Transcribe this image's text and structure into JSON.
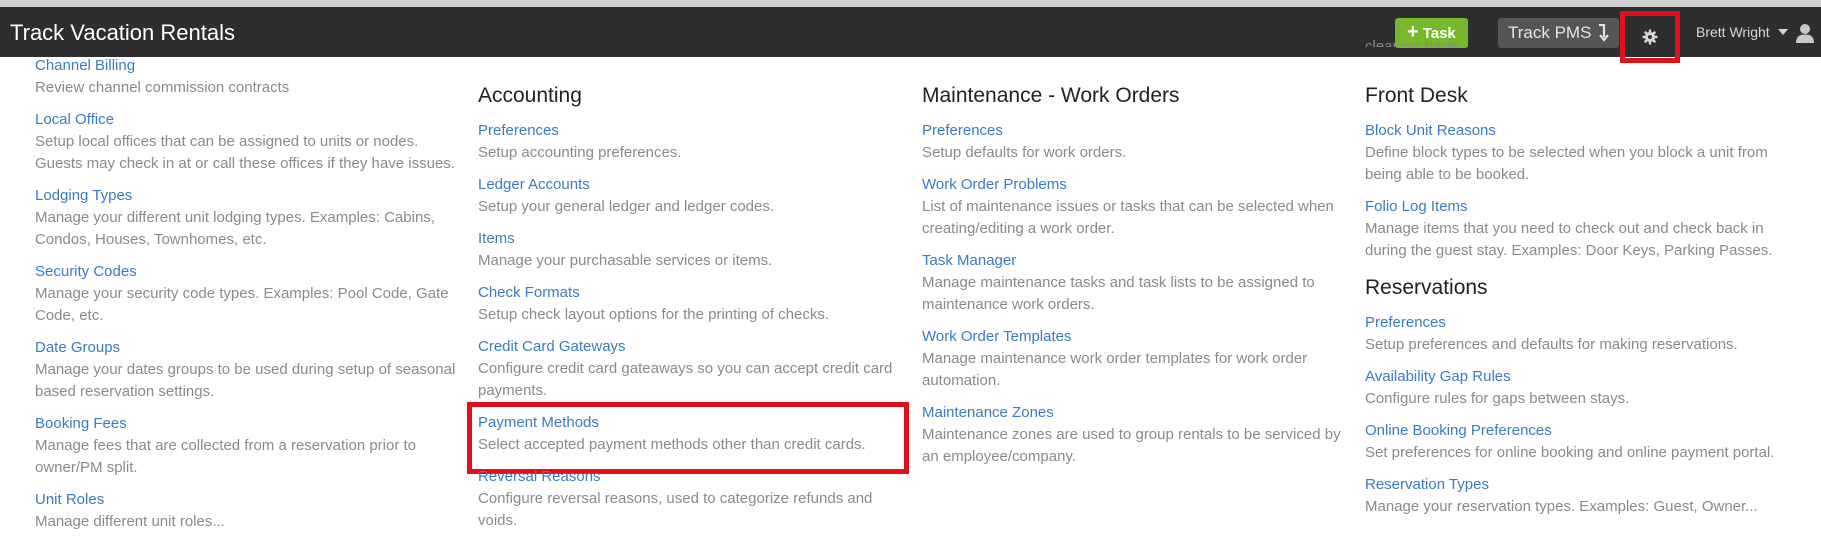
{
  "header": {
    "app_title": "Track Vacation Rentals",
    "task_label": "Task",
    "pms_label": "Track PMS",
    "user_name": "Brett Wright"
  },
  "columns": [
    {
      "sections": [
        {
          "items": [
            {
              "title": "Channel Billing",
              "desc": "Review channel commission contracts"
            },
            {
              "title": "Local Office",
              "desc": "Setup local offices that can be assigned to units or nodes. Guests may check in at or call these offices if they have issues."
            },
            {
              "title": "Lodging Types",
              "desc": "Manage your different unit lodging types. Examples: Cabins, Condos, Houses, Townhomes, etc."
            },
            {
              "title": "Security Codes",
              "desc": "Manage your security code types. Examples: Pool Code, Gate Code, etc."
            },
            {
              "title": "Date Groups",
              "desc": "Manage your dates groups to be used during setup of seasonal based reservation settings."
            },
            {
              "title": "Booking Fees",
              "desc": "Manage fees that are collected from a reservation prior to owner/PM split."
            },
            {
              "title": "Unit Roles",
              "desc": "Manage different unit roles..."
            }
          ]
        }
      ]
    },
    {
      "sections": [
        {
          "heading": "Accounting",
          "items": [
            {
              "title": "Preferences",
              "desc": "Setup accounting preferences."
            },
            {
              "title": "Ledger Accounts",
              "desc": "Setup your general ledger and ledger codes."
            },
            {
              "title": "Items",
              "desc": "Manage your purchasable services or items."
            },
            {
              "title": "Check Formats",
              "desc": "Setup check layout options for the printing of checks."
            },
            {
              "title": "Credit Card Gateways",
              "desc": "Configure credit card gateaways so you can accept credit card payments."
            },
            {
              "title": "Payment Methods",
              "desc": "Select accepted payment methods other than credit cards."
            },
            {
              "title": "Reversal Reasons",
              "desc": "Configure reversal reasons, used to categorize refunds and voids."
            }
          ]
        }
      ]
    },
    {
      "sections": [
        {
          "heading": "Maintenance - Work Orders",
          "items": [
            {
              "title": "Preferences",
              "desc": "Setup defaults for work orders."
            },
            {
              "title": "Work Order Problems",
              "desc": "List of maintenance issues or tasks that can be selected when creating/editing a work order."
            },
            {
              "title": "Task Manager",
              "desc": "Manage maintenance tasks and task lists to be assigned to maintenance work orders."
            },
            {
              "title": "Work Order Templates",
              "desc": "Manage maintenance work order templates for work order automation."
            },
            {
              "title": "Maintenance Zones",
              "desc": "Maintenance zones are used to group rentals to be serviced by an employee/company."
            }
          ]
        }
      ]
    },
    {
      "clipped_top": "cleaning types.",
      "sections": [
        {
          "heading": "Front Desk",
          "items": [
            {
              "title": "Block Unit Reasons",
              "desc": "Define block types to be selected when you block a unit from being able to be booked."
            },
            {
              "title": "Folio Log Items",
              "desc": "Manage items that you need to check out and check back in during the guest stay. Examples: Door Keys, Parking Passes."
            }
          ]
        },
        {
          "heading": "Reservations",
          "items": [
            {
              "title": "Preferences",
              "desc": "Setup preferences and defaults for making reservations."
            },
            {
              "title": "Availability Gap Rules",
              "desc": "Configure rules for gaps between stays."
            },
            {
              "title": "Online Booking Preferences",
              "desc": "Set preferences for online booking and online payment portal."
            },
            {
              "title": "Reservation Types",
              "desc": "Manage your reservation types. Examples: Guest, Owner..."
            }
          ]
        }
      ]
    }
  ]
}
